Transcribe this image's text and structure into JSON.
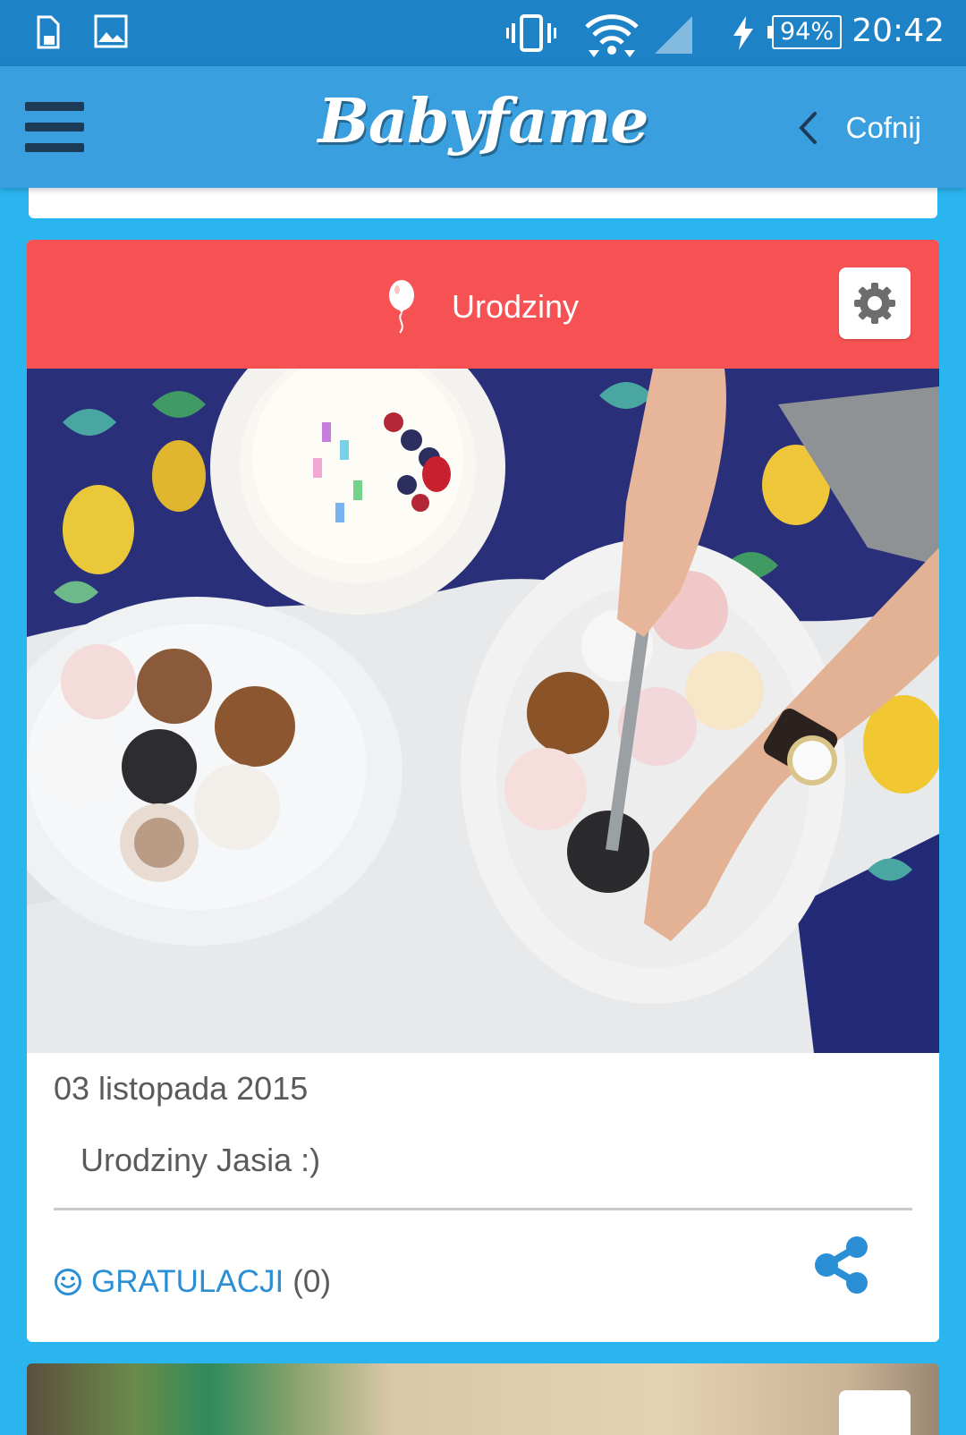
{
  "status_bar": {
    "time": "20:42",
    "battery": "94%",
    "icons": [
      "sd-card-icon",
      "image-icon",
      "vibrate-icon",
      "wifi-icon",
      "cell-signal-icon",
      "charging-icon"
    ]
  },
  "app_bar": {
    "brand": "Babyfame",
    "back_label": "Cofnij"
  },
  "post": {
    "category": "Urodziny",
    "header_color": "#f65253",
    "date": "03 listopada 2015",
    "description": "Urodziny Jasia :)",
    "congrats_label": "GRATULACJI",
    "congrats_count": "(0)"
  },
  "colors": {
    "status_bar": "#1d82c6",
    "app_bar": "#3a9fde",
    "background": "#2bb5ef",
    "accent_blue": "#2b8fd6"
  }
}
